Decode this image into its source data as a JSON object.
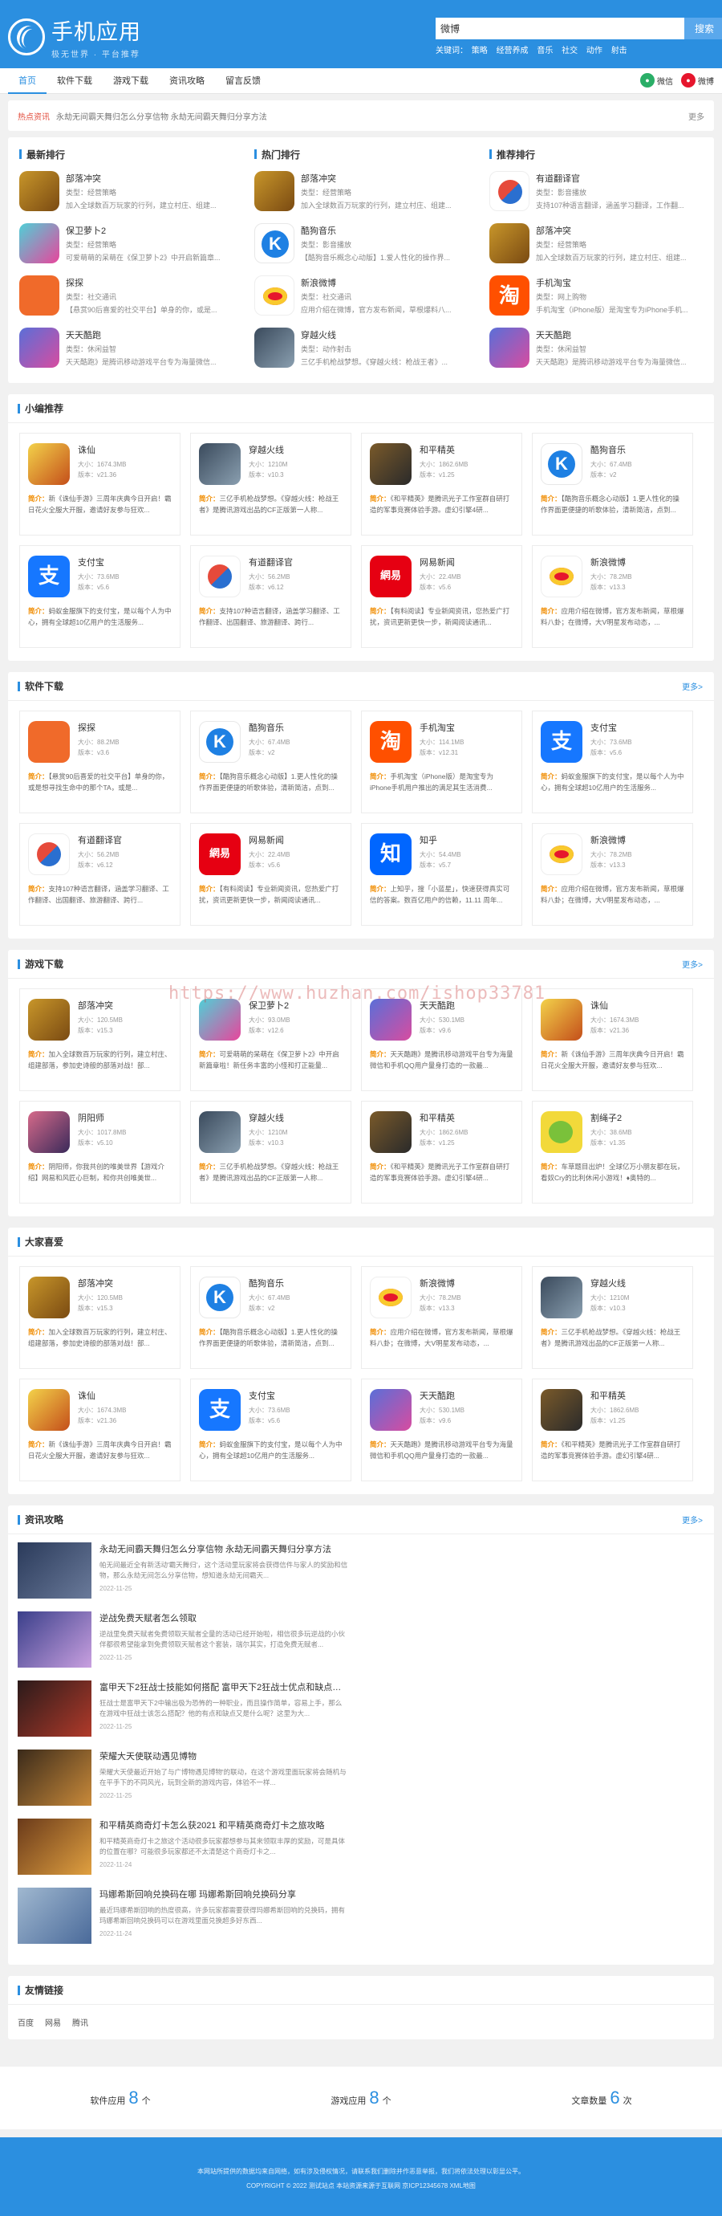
{
  "header": {
    "logo_name": "手机应用",
    "logo_sub": "极无世界 · 平台推荐",
    "search_value": "微博",
    "search_button": "搜索",
    "keywords_label": "关键词：",
    "keywords": [
      "策略",
      "经营养成",
      "音乐",
      "社交",
      "动作",
      "射击"
    ]
  },
  "nav": {
    "items": [
      "首页",
      "软件下载",
      "游戏下载",
      "资讯攻略",
      "留言反馈"
    ],
    "share_wechat": "微信",
    "share_weibo": "微博"
  },
  "hotbar": {
    "label": "热点资讯",
    "text": "永劫无间霸天舞归怎么分享信物 永劫无间霸天舞归分享方法",
    "more": "更多"
  },
  "columns": [
    {
      "title": "最新排行",
      "items": [
        {
          "icon": "i-coc",
          "name": "部落冲突",
          "type": "类型：经营策略",
          "desc": "加入全球数百万玩家的行列，建立村庄、组建..."
        },
        {
          "icon": "i-bao",
          "name": "保卫萝卜2",
          "type": "类型：经营策略",
          "desc": "可爱萌萌的呆萌在《保卫萝卜2》中开启新篇章..."
        },
        {
          "icon": "i-tan",
          "name": "探探",
          "type": "类型：社交通讯",
          "desc": "【悬赏90后喜爱的社交平台】单身的你，或是..."
        },
        {
          "icon": "i-tian",
          "name": "天天酷跑",
          "type": "类型：休闲益智",
          "desc": "天天酷跑》是腾讯移动游戏平台专为海量微信..."
        }
      ]
    },
    {
      "title": "热门排行",
      "items": [
        {
          "icon": "i-coc",
          "name": "部落冲突",
          "type": "类型：经营策略",
          "desc": "加入全球数百万玩家的行列，建立村庄、组建..."
        },
        {
          "icon": "i-koo",
          "name": "酷狗音乐",
          "type": "类型：影音播放",
          "desc": "【酷狗音乐概念心动版】1.爱人性化的操作界..."
        },
        {
          "icon": "i-weibo",
          "name": "新浪微博",
          "type": "类型：社交通讯",
          "desc": "应用介绍在微博，官方发布新闻，草根爆料八..."
        },
        {
          "icon": "i-cf",
          "name": "穿越火线",
          "type": "类型：动作射击",
          "desc": "三亿手机枪战梦想。《穿越火线：枪战王者》..."
        }
      ]
    },
    {
      "title": "推荐排行",
      "items": [
        {
          "icon": "i-ydao",
          "name": "有道翻译官",
          "type": "类型：影音播放",
          "desc": "支持107种语言翻译，涵盖学习翻译，工作翻..."
        },
        {
          "icon": "i-coc",
          "name": "部落冲突",
          "type": "类型：经营策略",
          "desc": "加入全球数百万玩家的行列，建立村庄、组建..."
        },
        {
          "icon": "i-tb",
          "glyph": "淘",
          "name": "手机淘宝",
          "type": "类型：网上购物",
          "desc": "手机淘宝（iPhone版）是淘宝专为iPhone手机..."
        },
        {
          "icon": "i-tian",
          "name": "天天酷跑",
          "type": "类型：休闲益智",
          "desc": "天天酷跑》是腾讯移动游戏平台专为海量微信..."
        }
      ]
    }
  ],
  "sections": [
    {
      "title": "小编推荐",
      "more": "",
      "cards": [
        {
          "icon": "i-zhu",
          "glyph": "",
          "name": "诛仙",
          "size": "大小：1674.3MB",
          "ver": "版本：v21.36",
          "desc": "新《诛仙手游》三周年庆典今日开启！霸日花火全服大开服，邀请好友参与狂欢..."
        },
        {
          "icon": "i-cf",
          "glyph": "",
          "name": "穿越火线",
          "size": "大小：1210M",
          "ver": "版本：v10.3",
          "desc": "三亿手机枪战梦想。《穿越火线：枪战王者》是腾讯游戏出品的CF正版第一人称..."
        },
        {
          "icon": "i-hpjy",
          "glyph": "",
          "name": "和平精英",
          "size": "大小：1862.6MB",
          "ver": "版本：v1.25",
          "desc": "《和平精英》是腾讯光子工作室群自研打造的军事竞赛体验手游。虚幻引擎4研..."
        },
        {
          "icon": "i-koo",
          "glyph": "",
          "name": "酷狗音乐",
          "size": "大小：67.4MB",
          "ver": "版本：v2",
          "desc": "【酷狗音乐概念心动版】1.更人性化的操作界面更便捷的听歌体验，清新简洁，点到..."
        },
        {
          "icon": "i-zfb",
          "glyph": "支",
          "name": "支付宝",
          "size": "大小：73.6MB",
          "ver": "版本：v5.6",
          "desc": "蚂蚁金服旗下的支付宝，是以每个人为中心，拥有全球超10亿用户的生活服务..."
        },
        {
          "icon": "i-ydao",
          "glyph": "",
          "name": "有道翻译官",
          "size": "大小：56.2MB",
          "ver": "版本：v6.12",
          "desc": "支持107种语言翻译，涵盖学习翻译、工作翻译、出国翻译、旅游翻译、跨行..."
        },
        {
          "icon": "i-163",
          "glyph": "網易",
          "name": "网易新闻",
          "size": "大小：22.4MB",
          "ver": "版本：v5.6",
          "desc": "【有料阅读】专业新闻资讯，您热爱广打扰，资讯更新更快一步，新闻阅读通讯..."
        },
        {
          "icon": "i-weibo",
          "glyph": "",
          "name": "新浪微博",
          "size": "大小：78.2MB",
          "ver": "版本：v13.3",
          "desc": "应用介绍在微博，官方发布新闻，草根爆料八卦；在微博，大V明星发布动态，..."
        }
      ]
    },
    {
      "title": "软件下载",
      "more": "更多>",
      "cards": [
        {
          "icon": "i-tan",
          "glyph": "",
          "name": "探探",
          "size": "大小：88.2MB",
          "ver": "版本：v3.6",
          "desc": "【悬赏90后喜爱的社交平台】单身的你，或是想寻找生命中的那个TA，或是..."
        },
        {
          "icon": "i-koo",
          "glyph": "",
          "name": "酷狗音乐",
          "size": "大小：67.4MB",
          "ver": "版本：v2",
          "desc": "【酷狗音乐概念心动版】1.更人性化的操作界面更便捷的听歌体验，清新简洁，点到..."
        },
        {
          "icon": "i-tb",
          "glyph": "淘",
          "name": "手机淘宝",
          "size": "大小：114.1MB",
          "ver": "版本：v12.31",
          "desc": "手机淘宝（iPhone版）是淘宝专为iPhone手机用户推出的满足其生活消费..."
        },
        {
          "icon": "i-zfb",
          "glyph": "支",
          "name": "支付宝",
          "size": "大小：73.6MB",
          "ver": "版本：v5.6",
          "desc": "蚂蚁金服旗下的支付宝，是以每个人为中心，拥有全球超10亿用户的生活服务..."
        },
        {
          "icon": "i-ydao",
          "glyph": "",
          "name": "有道翻译官",
          "size": "大小：56.2MB",
          "ver": "版本：v6.12",
          "desc": "支持107种语言翻译，涵盖学习翻译、工作翻译、出国翻译、旅游翻译、跨行..."
        },
        {
          "icon": "i-163",
          "glyph": "網易",
          "name": "网易新闻",
          "size": "大小：22.4MB",
          "ver": "版本：v5.6",
          "desc": "【有料阅读】专业新闻资讯，您热爱广打扰，资讯更新更快一步，新闻阅读通讯..."
        },
        {
          "icon": "i-zhi",
          "glyph": "知",
          "name": "知乎",
          "size": "大小：54.4MB",
          "ver": "版本：v5.7",
          "desc": "上知乎，搜「小蓝星」，快速获得真实可信的答案。数百亿用户的信赖，11.11 周年..."
        },
        {
          "icon": "i-weibo",
          "glyph": "",
          "name": "新浪微博",
          "size": "大小：78.2MB",
          "ver": "版本：v13.3",
          "desc": "应用介绍在微博，官方发布新闻，草根爆料八卦；在微博，大V明星发布动态，..."
        }
      ]
    },
    {
      "title": "游戏下载",
      "more": "更多>",
      "cards": [
        {
          "icon": "i-coc",
          "glyph": "",
          "name": "部落冲突",
          "size": "大小：120.5MB",
          "ver": "版本：v15.3",
          "desc": "加入全球数百万玩家的行列，建立村庄、组建部落，参加史诗般的部落对战！部..."
        },
        {
          "icon": "i-bao",
          "glyph": "",
          "name": "保卫萝卜2",
          "size": "大小：93.0MB",
          "ver": "版本：v12.6",
          "desc": "可爱萌萌的呆萌在《保卫萝卜2》中开启新篇章啦！新任务丰富的小怪和打正能量..."
        },
        {
          "icon": "i-tian",
          "glyph": "",
          "name": "天天酷跑",
          "size": "大小：530.1MB",
          "ver": "版本：v9.6",
          "desc": "天天酷跑》是腾讯移动游戏平台专为海量微信和手机QQ用户量身打造的一款最..."
        },
        {
          "icon": "i-zhu",
          "glyph": "",
          "name": "诛仙",
          "size": "大小：1674.3MB",
          "ver": "版本：v21.36",
          "desc": "新《诛仙手游》三周年庆典今日开启！霸日花火全服大开服，邀请好友参与狂欢..."
        },
        {
          "icon": "i-yin",
          "glyph": "",
          "name": "阴阳师",
          "size": "大小：1017.8MB",
          "ver": "版本：v5.10",
          "desc": "阴阳师，你我共创的唯美世界【游戏介绍】网易和风匠心巨制，和你共创唯美世..."
        },
        {
          "icon": "i-cf",
          "glyph": "",
          "name": "穿越火线",
          "size": "大小：1210M",
          "ver": "版本：v10.3",
          "desc": "三亿手机枪战梦想。《穿越火线：枪战王者》是腾讯游戏出品的CF正版第一人称..."
        },
        {
          "icon": "i-hpjy",
          "glyph": "",
          "name": "和平精英",
          "size": "大小：1862.6MB",
          "ver": "版本：v1.25",
          "desc": "《和平精英》是腾讯光子工作室群自研打造的军事竞赛体验手游。虚幻引擎4研..."
        },
        {
          "icon": "i-cut",
          "glyph": "",
          "name": "割绳子2",
          "size": "大小：38.6MB",
          "ver": "版本：v1.35",
          "desc": "车草题目出炉！全球亿万小朋友都在玩，看奴Cry的比利休闲小游戏！♦奥特的..."
        }
      ]
    },
    {
      "title": "大家喜爱",
      "more": "",
      "cards": [
        {
          "icon": "i-coc",
          "glyph": "",
          "name": "部落冲突",
          "size": "大小：120.5MB",
          "ver": "版本：v15.3",
          "desc": "加入全球数百万玩家的行列，建立村庄、组建部落，参加史诗般的部落对战！部..."
        },
        {
          "icon": "i-koo",
          "glyph": "",
          "name": "酷狗音乐",
          "size": "大小：67.4MB",
          "ver": "版本：v2",
          "desc": "【酷狗音乐概念心动版】1.更人性化的操作界面更便捷的听歌体验，清新简洁，点到..."
        },
        {
          "icon": "i-weibo",
          "glyph": "",
          "name": "新浪微博",
          "size": "大小：78.2MB",
          "ver": "版本：v13.3",
          "desc": "应用介绍在微博，官方发布新闻，草根爆料八卦；在微博，大V明星发布动态，..."
        },
        {
          "icon": "i-cf",
          "glyph": "",
          "name": "穿越火线",
          "size": "大小：1210M",
          "ver": "版本：v10.3",
          "desc": "三亿手机枪战梦想。《穿越火线：枪战王者》是腾讯游戏出品的CF正版第一人称..."
        },
        {
          "icon": "i-zhu",
          "glyph": "",
          "name": "诛仙",
          "size": "大小：1674.3MB",
          "ver": "版本：v21.36",
          "desc": "新《诛仙手游》三周年庆典今日开启！霸日花火全服大开服，邀请好友参与狂欢..."
        },
        {
          "icon": "i-zfb",
          "glyph": "支",
          "name": "支付宝",
          "size": "大小：73.6MB",
          "ver": "版本：v5.6",
          "desc": "蚂蚁金服旗下的支付宝，是以每个人为中心，拥有全球超10亿用户的生活服务..."
        },
        {
          "icon": "i-tian",
          "glyph": "",
          "name": "天天酷跑",
          "size": "大小：530.1MB",
          "ver": "版本：v9.6",
          "desc": "天天酷跑》是腾讯移动游戏平台专为海量微信和手机QQ用户量身打造的一款最..."
        },
        {
          "icon": "i-hpjy",
          "glyph": "",
          "name": "和平精英",
          "size": "大小：1862.6MB",
          "ver": "版本：v1.25",
          "desc": "《和平精英》是腾讯光子工作室群自研打造的军事竞赛体验手游。虚幻引擎4研..."
        }
      ]
    }
  ],
  "news": {
    "title": "资讯攻略",
    "more": "更多>",
    "items": [
      {
        "thumb": "n1",
        "title": "永劫无间霸天舞归怎么分享信物 永劫无间霸天舞归分享方法",
        "desc": "帕无间最近全有新活动'霸天舞归'，这个活动里玩家将会获得信件与家人的奖励和信物，那么永劫无间怎么分享信物，想知道永劫无间霸天...",
        "date": "2022-11-25"
      },
      {
        "thumb": "n2",
        "title": "逆战免费天赋者怎么领取",
        "desc": "逆战里免费天赋者免费领取天赋者全量的活动已经开始啦，相信很多玩逆战的小伙伴都很希望能拿到免费领取天赋者这个套装，瑞尔其实，打造免费无赋者...",
        "date": "2022-11-25"
      },
      {
        "thumb": "n3",
        "title": "富甲天下2狂战士技能如何搭配 富甲天下2狂战士优点和缺点分析",
        "desc": "狂战士是富甲天下2中输出极为恐怖的一种职业，而且操作简单，容易上手，那么在游戏中狂战士该怎么搭配？他的有点和缺点又是什么呢？这里为大...",
        "date": "2022-11-25"
      },
      {
        "thumb": "n4",
        "title": "荣耀大天使联动遇见博物",
        "desc": "荣耀大天使最近开始了与广博物遇见博物'的联动，在这个游戏里面玩家将会随机与在平手下的不同风光，玩到全新的游戏内容，体验不一样...",
        "date": "2022-11-25"
      },
      {
        "thumb": "n5",
        "title": "和平精英商奇灯卡怎么获2021 和平精英商奇灯卡之旅攻略",
        "desc": "和平精英商奇灯卡之旅这个活动很多玩家都想参与其来领取丰厚的奖励，可是具体的位置在哪？可能很多玩家都还不太清楚这个商奇灯卡之...",
        "date": "2022-11-24"
      },
      {
        "thumb": "n6",
        "title": "玛娜希斯回响兑换码在哪 玛娜希斯回响兑换码分享",
        "desc": "最近玛娜希斯回响的热度很高，许多玩家都需要获得玛娜希斯回响的兑换码，拥有玛娜希斯回响兑换码可以在游戏里面兑换超多好东西...",
        "date": "2022-11-24"
      }
    ]
  },
  "links": {
    "title": "友情链接",
    "items": [
      "百度",
      "网易",
      "腾讯"
    ]
  },
  "stats": [
    {
      "label": "软件应用",
      "value": "8",
      "unit": "个"
    },
    {
      "label": "游戏应用",
      "value": "8",
      "unit": "个"
    },
    {
      "label": "文章数量",
      "value": "6",
      "unit": "次"
    }
  ],
  "footer": {
    "line1": "本网站所提供的数据均来自网络，如有涉及侵权情况，请联系我们删除并作恶意举报，我们将依法处理以彰显公平。",
    "line2": "COPYRIGHT © 2022 测试站点 本站资源来源于互联网 京ICP12345678 XML地图"
  },
  "watermark": "https://www.huzhan.com/ishop33781"
}
